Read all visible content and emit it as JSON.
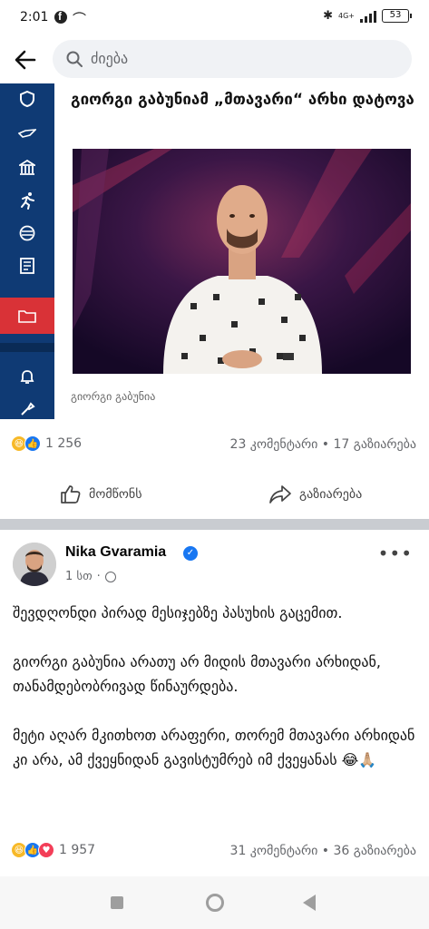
{
  "status_bar": {
    "time": "2:01",
    "network": "4G+",
    "battery": "53"
  },
  "search": {
    "placeholder": "ძიება"
  },
  "shared_post": {
    "article_title": "გიორგი გაბუნიამ „მთავარი“ არხი დატოვა",
    "photo_caption": "გიორგი გაბუნია",
    "reaction_count": "1 256",
    "stats": "23 კომენტარი • 17 გაზიარება",
    "like_label": "მომწონს",
    "share_label": "გაზიარება"
  },
  "post": {
    "author": "Nika Gvaramia",
    "time": "1 სთ",
    "paragraphs": [
      "შევდღონდი პირად მესიჯებზე პასუხის გაცემით.",
      "გიორგი გაბუნია არათუ არ მიდის მთავარი არხიდან, თანამდებობრივად წინაურდება.",
      "მეტი აღარ მკითხოთ არაფერი, თორემ მთავარი არხიდან კი არა, ამ ქვეყნიდან გავისტუმრებ იმ ქვეყანას 😂🙏🏼"
    ],
    "reaction_count": "1 957",
    "stats": "31 კომენტარი • 36 გაზიარება"
  },
  "icons": {
    "status_fb": "facebook-icon",
    "back": "back-arrow-icon",
    "search": "search-icon",
    "like": "thumbs-up-icon",
    "share": "share-arrow-icon",
    "verified": "verified-badge-icon",
    "globe": "globe-icon",
    "more": "more-icon"
  },
  "colors": {
    "facebook_blue": "#1877f2",
    "nav_blue": "#0f3a74",
    "nav_red": "#d93237"
  }
}
